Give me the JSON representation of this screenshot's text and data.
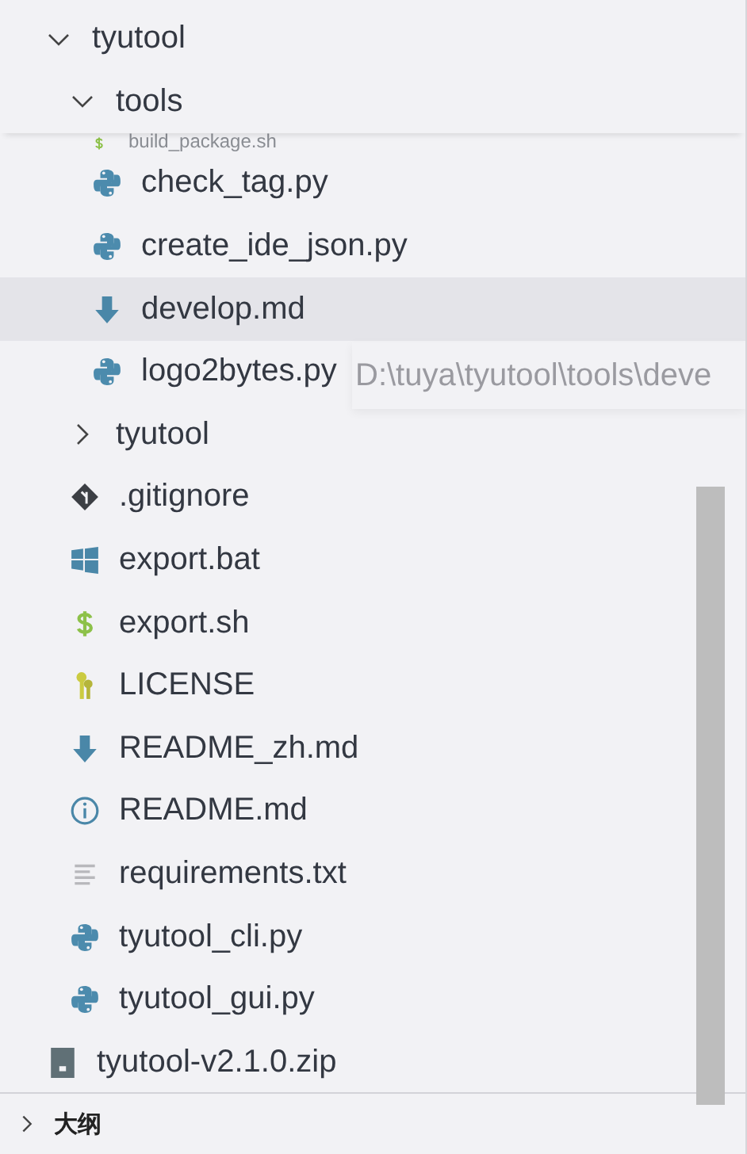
{
  "explorer": {
    "tree": [
      {
        "label": "tyutool",
        "kind": "folder",
        "expanded": true,
        "selected": false,
        "children": [
          {
            "label": "tools",
            "kind": "folder",
            "expanded": true,
            "selected": false,
            "children": [
              {
                "label": "build_package.sh",
                "kind": "shell",
                "selected": false,
                "partial": true
              },
              {
                "label": "check_tag.py",
                "kind": "python",
                "selected": false
              },
              {
                "label": "create_ide_json.py",
                "kind": "python",
                "selected": false
              },
              {
                "label": "develop.md",
                "kind": "markdown",
                "selected": true
              },
              {
                "label": "logo2bytes.py",
                "kind": "python",
                "selected": false
              }
            ]
          },
          {
            "label": "tyutool",
            "kind": "folder",
            "expanded": false,
            "selected": false
          },
          {
            "label": ".gitignore",
            "kind": "git",
            "selected": false
          },
          {
            "label": "export.bat",
            "kind": "windows",
            "selected": false
          },
          {
            "label": "export.sh",
            "kind": "shell",
            "selected": false
          },
          {
            "label": "LICENSE",
            "kind": "license",
            "selected": false
          },
          {
            "label": "README_zh.md",
            "kind": "markdown",
            "selected": false
          },
          {
            "label": "README.md",
            "kind": "info",
            "selected": false
          },
          {
            "label": "requirements.txt",
            "kind": "text",
            "selected": false
          },
          {
            "label": "tyutool_cli.py",
            "kind": "python",
            "selected": false
          },
          {
            "label": "tyutool_gui.py",
            "kind": "python",
            "selected": false
          }
        ]
      },
      {
        "label": "tyutool-v2.1.0.zip",
        "kind": "zip",
        "selected": false
      }
    ],
    "tooltip": "D:\\tuya\\tyutool\\tools\\deve"
  },
  "outline": {
    "title": "大纲",
    "expanded": false
  }
}
